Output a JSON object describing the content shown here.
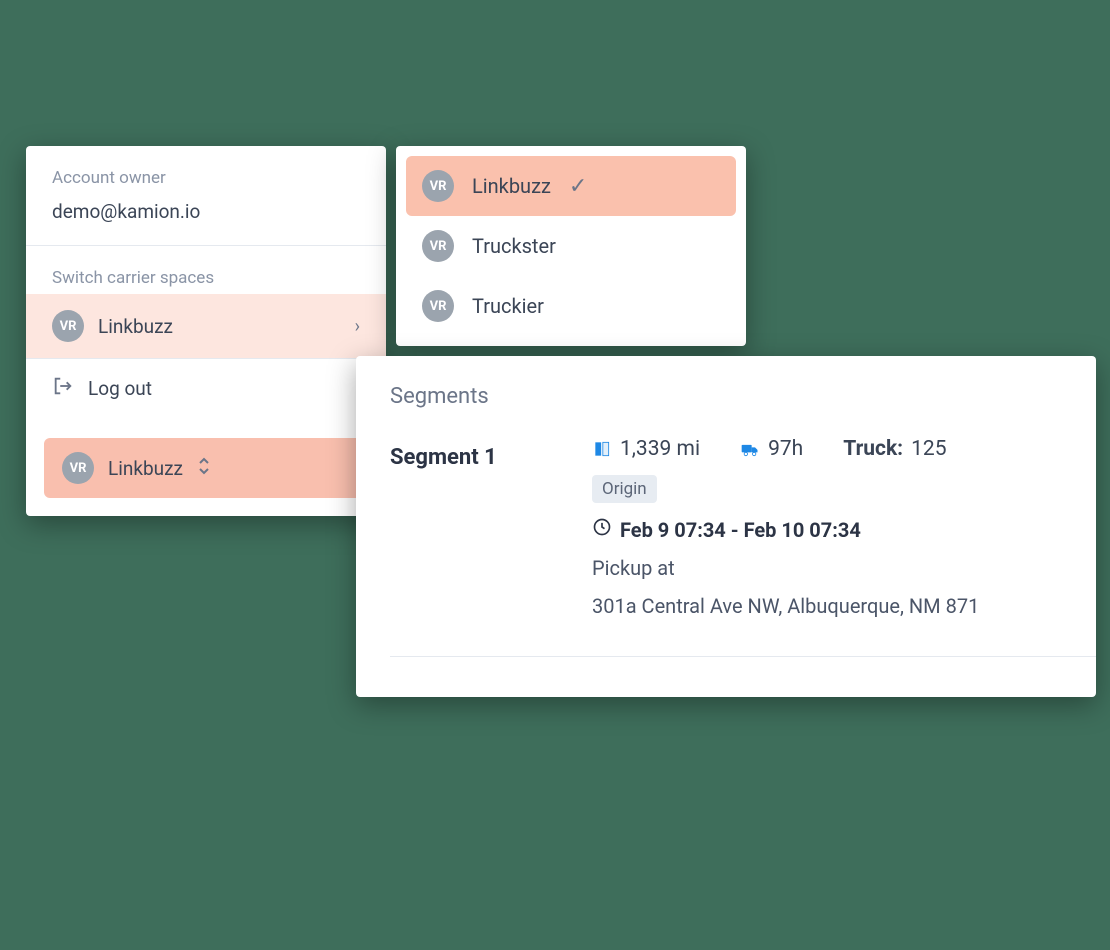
{
  "account": {
    "owner_label": "Account owner",
    "owner_value": "demo@kamion.io",
    "switch_label": "Switch carrier spaces",
    "current_carrier_badge": "VR",
    "current_carrier_name": "Linkbuzz",
    "logout_label": "Log out",
    "footer_badge": "VR",
    "footer_carrier": "Linkbuzz"
  },
  "carriers": [
    {
      "badge": "VR",
      "name": "Linkbuzz",
      "selected": true
    },
    {
      "badge": "VR",
      "name": "Truckster",
      "selected": false
    },
    {
      "badge": "VR",
      "name": "Truckier",
      "selected": false
    }
  ],
  "segments": {
    "title": "Segments",
    "seg1": {
      "label": "Segment 1",
      "distance": "1,339 mi",
      "duration": "97h",
      "truck_label": "Truck:",
      "truck_value": "125",
      "origin_badge": "Origin",
      "time_window": "Feb 9 07:34 - Feb 10 07:34",
      "pickup_prefix": "Pickup at",
      "address": "301a Central Ave NW, Albuquerque, NM 871"
    }
  }
}
